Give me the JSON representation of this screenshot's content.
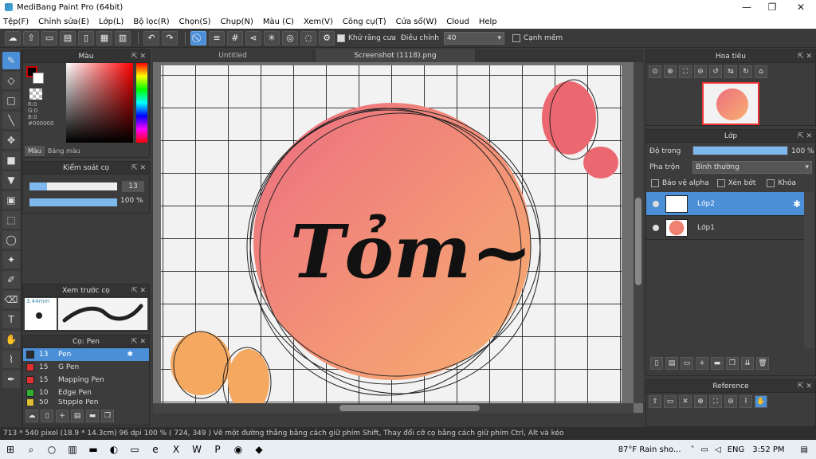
{
  "window": {
    "title": "MediBang Paint Pro (64bit)",
    "min": "—",
    "max": "❐",
    "close": "✕"
  },
  "menu": [
    "Tệp(F)",
    "Chỉnh sửa(E)",
    "Lớp(L)",
    "Bộ lọc(R)",
    "Chọn(S)",
    "Chụp(N)",
    "Màu (C)",
    "Xem(V)",
    "Công cụ(T)",
    "Cửa sổ(W)",
    "Cloud",
    "Help"
  ],
  "toolbar": {
    "antialias_label": "Khử răng cưa",
    "adjust_label": "Điều chỉnh",
    "adjust_value": "40",
    "edge_label": "Cạnh mềm"
  },
  "tabs": [
    "Untitled",
    "Screenshot (1118).png"
  ],
  "color_panel": {
    "title": "Màu",
    "r": "R:0",
    "g": "G:0",
    "b": "B:0",
    "hex": "#000000",
    "tab_color": "Màu",
    "tab_palette": "Bảng màu"
  },
  "brush_control": {
    "title": "Kiểm soát cọ",
    "size": "13",
    "opacity": "100 %",
    "size_frac": 0.2,
    "opacity_frac": 1.0
  },
  "brush_preview": {
    "title": "Xem trước cọ",
    "size_label": "3.44mm"
  },
  "brush_list": {
    "title": "Cọ: Pen",
    "items": [
      {
        "size": "13",
        "name": "Pen",
        "color": "#2a2a2a"
      },
      {
        "size": "15",
        "name": "G Pen",
        "color": "#e03030"
      },
      {
        "size": "15",
        "name": "Mapping Pen",
        "color": "#e03030"
      },
      {
        "size": "10",
        "name": "Edge Pen",
        "color": "#30b030"
      },
      {
        "size": "50",
        "name": "Stipple Pen",
        "color": "#e0c030"
      }
    ]
  },
  "navigator": {
    "title": "Hoa tiêu"
  },
  "layer_panel": {
    "title": "Lớp",
    "opacity_label": "Độ trong",
    "opacity_value": "100 %",
    "blend_label": "Pha trộn",
    "blend_value": "Bình thường",
    "alpha_label": "Bảo vệ alpha",
    "clip_label": "Xén bớt",
    "lock_label": "Khóa",
    "layers": [
      {
        "name": "Lớp2"
      },
      {
        "name": "Lớp1"
      }
    ]
  },
  "reference": {
    "title": "Reference"
  },
  "canvas": {
    "text": "Tỏm~"
  },
  "status": "713 * 540 pixel   (18.9 * 14.3cm)   96 dpi   100 %   ( 724, 349 )   Vẽ một đường thẳng bằng cách giữ phím Shift, Thay đổi cỡ cọ bằng cách giữ phím Ctrl, Alt và kéo",
  "taskbar": {
    "weather": "87°F  Rain sho...",
    "lang": "ENG",
    "time": "3:52 PM"
  }
}
